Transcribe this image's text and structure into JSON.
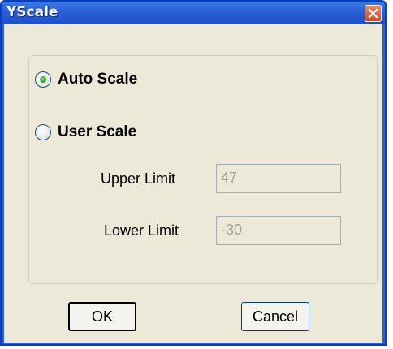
{
  "window": {
    "title": "YScale",
    "close_icon": "close-icon"
  },
  "scale_mode": {
    "selected": "auto",
    "auto_label": "Auto Scale",
    "user_label": "User Scale"
  },
  "limits": {
    "upper_label": "Upper Limit",
    "upper_value": "47",
    "lower_label": "Lower Limit",
    "lower_value": "-30"
  },
  "buttons": {
    "ok_label": "OK",
    "cancel_label": "Cancel"
  },
  "colors": {
    "titlebar": "#2a5fd6",
    "client_bg": "#ece9d8",
    "close_button": "#d8481e",
    "radio_selected": "#2aa52a"
  }
}
